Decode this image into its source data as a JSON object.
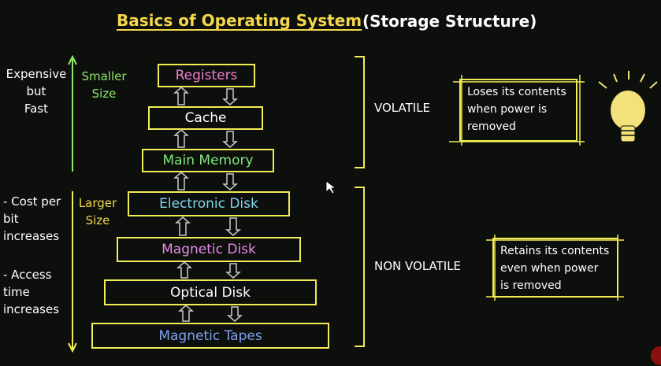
{
  "title": "Basics of Operating System",
  "subtitle": "(Storage Structure)",
  "left_labels": {
    "expensive_fast": "Expensive\nbut\nFast",
    "smaller_size": "Smaller\nSize",
    "cost_increases": "- Cost per\nbit\nincreases",
    "access_time": "- Access\ntime\nincreases",
    "larger_size": "Larger\nSize"
  },
  "hierarchy": [
    {
      "label": "Registers",
      "color": "#f27dd0"
    },
    {
      "label": "Cache",
      "color": "#ffffff"
    },
    {
      "label": "Main Memory",
      "color": "#7fe87f"
    },
    {
      "label": "Electronic Disk",
      "color": "#7fd6ee"
    },
    {
      "label": "Magnetic Disk",
      "color": "#e98be8"
    },
    {
      "label": "Optical Disk",
      "color": "#ffffff"
    },
    {
      "label": "Magnetic Tapes",
      "color": "#7fa0f0"
    }
  ],
  "groups": {
    "volatile": {
      "label": "VOLATILE",
      "note": "Loses its contents\nwhen power is\nremoved"
    },
    "non_volatile": {
      "label": "NON VOLATILE",
      "note": "Retains its contents\neven when power\nis removed"
    }
  },
  "colors": {
    "accent_yellow": "#f2ec55",
    "title_yellow": "#f4d84a",
    "green_text": "#8ee86a",
    "arrow_grey": "#c9c9c9",
    "bulb": "#f3e27a"
  },
  "icons": [
    "light-bulb-icon",
    "mouse-cursor-icon"
  ]
}
